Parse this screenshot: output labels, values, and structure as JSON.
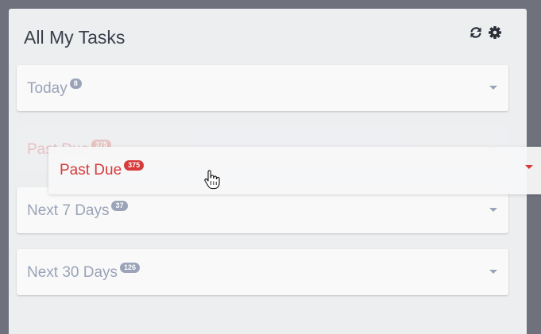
{
  "panel": {
    "title": "All My Tasks",
    "icons": [
      "refresh-icon",
      "gear-icon"
    ]
  },
  "cards": [
    {
      "label": "Today",
      "count": "8"
    },
    {
      "label": "Past Due",
      "count": "375"
    },
    {
      "label": "Next 7 Days",
      "count": "37"
    },
    {
      "label": "Next 30 Days",
      "count": "126"
    }
  ],
  "drag": {
    "label": "Past Due",
    "count": "375"
  },
  "colors": {
    "background": "#6f727d",
    "panel": "#eceef0",
    "muted": "#9aa3b8",
    "past_due_red": "#d63a3a"
  }
}
